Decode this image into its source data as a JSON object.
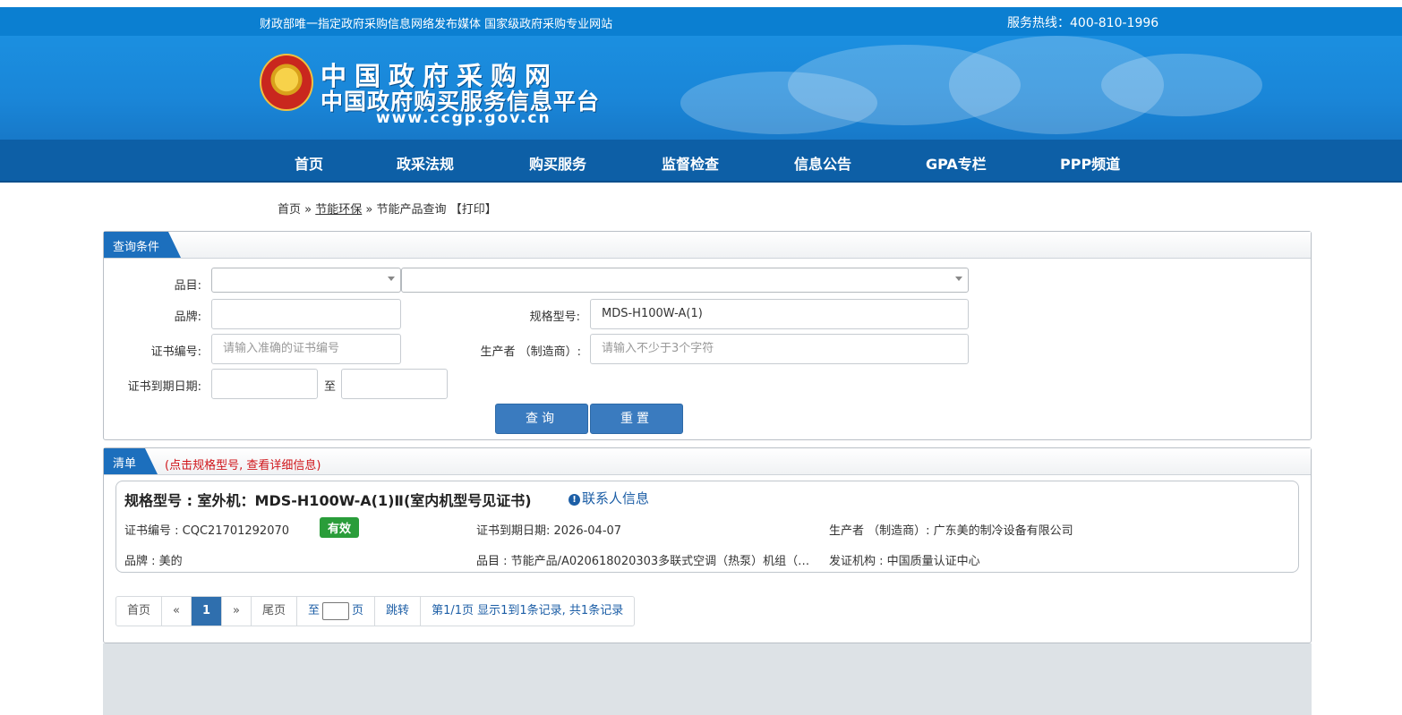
{
  "header": {
    "slogan": "财政部唯一指定政府采购信息网络发布媒体 国家级政府采购专业网站",
    "hotline": "服务热线：400-810-1996",
    "logo_title": "中国政府采购网",
    "logo_subtitle": "中国政府购买服务信息平台",
    "logo_url": "www.ccgp.gov.cn"
  },
  "nav": {
    "items": [
      "首页",
      "政采法规",
      "购买服务",
      "监督检查",
      "信息公告",
      "GPA专栏",
      "PPP频道"
    ]
  },
  "breadcrumb": {
    "home": "首页",
    "sep1": "»",
    "section": "节能环保",
    "sep2": "»",
    "current": "节能产品查询",
    "print": "【打印】"
  },
  "query": {
    "tab": "查询条件",
    "category_label": "品目:",
    "brand_label": "品牌:",
    "brand_value": "",
    "model_label": "规格型号:",
    "model_value": "MDS-H100W-A(1)",
    "cert_label": "证书编号:",
    "cert_placeholder": "请输入准确的证书编号",
    "maker_label": "生产者 （制造商）:",
    "maker_placeholder": "请输入不少于3个字符",
    "expire_label": "证书到期日期:",
    "to": "至",
    "search_btn": "查询",
    "reset_btn": "重置"
  },
  "list": {
    "tab": "清单",
    "hint": "(点击规格型号, 查看详细信息)",
    "result": {
      "model_prefix": "规格型号 : ",
      "model": "室外机：MDS-H100W-A(1)Ⅱ(室内机型号见证书)",
      "contact": "联系人信息",
      "cert_no": "证书编号 : CQC21701292070",
      "status": "有效",
      "expire": "证书到期日期: 2026-04-07",
      "maker": "生产者 （制造商）: 广东美的制冷设备有限公司",
      "brand": "品牌 : 美的",
      "category": "品目 : 节能产品/A020618020303多联式空调（热泵）机组（…",
      "issuer": "发证机构 : 中国质量认证中心"
    },
    "pager": {
      "first": "首页",
      "prev": "«",
      "current": "1",
      "next": "»",
      "last": "尾页",
      "to": "至",
      "page_unit": "页",
      "jump": "跳转",
      "info": "第1/1页  显示1到1条记录, 共1条记录"
    }
  },
  "colors": {
    "brand_blue": "#0d5fa6",
    "tab_blue": "#1c6fbd",
    "valid_green": "#2a9d3a",
    "hint_red": "#d0161b"
  }
}
